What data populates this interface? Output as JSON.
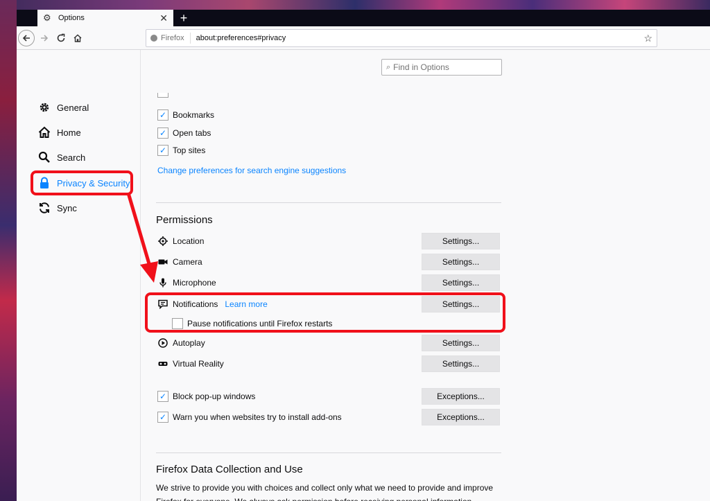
{
  "browser": {
    "tab_title": "Options",
    "new_tab": "+",
    "url_identity": "Firefox",
    "url": "about:preferences#privacy"
  },
  "sidebar": {
    "items": [
      {
        "label": "General",
        "icon": "gear-icon"
      },
      {
        "label": "Home",
        "icon": "home-icon"
      },
      {
        "label": "Search",
        "icon": "search-icon"
      },
      {
        "label": "Privacy & Security",
        "icon": "lock-icon",
        "active": true
      },
      {
        "label": "Sync",
        "icon": "sync-icon"
      }
    ]
  },
  "search": {
    "placeholder": "Find in Options"
  },
  "suggestions": {
    "items": [
      {
        "label": "Bookmarks",
        "checked": true
      },
      {
        "label": "Open tabs",
        "checked": true
      },
      {
        "label": "Top sites",
        "checked": true
      }
    ],
    "change_link": "Change preferences for search engine suggestions"
  },
  "permissions": {
    "title": "Permissions",
    "items": [
      {
        "label": "Location",
        "icon": "location-icon",
        "button": "Settings..."
      },
      {
        "label": "Camera",
        "icon": "camera-icon",
        "button": "Settings..."
      },
      {
        "label": "Microphone",
        "icon": "microphone-icon",
        "button": "Settings..."
      },
      {
        "label": "Notifications",
        "icon": "notification-icon",
        "button": "Settings...",
        "learn_more": "Learn more"
      },
      {
        "label": "Autoplay",
        "icon": "autoplay-icon",
        "button": "Settings..."
      },
      {
        "label": "Virtual Reality",
        "icon": "vr-icon",
        "button": "Settings..."
      }
    ],
    "pause_notifications": {
      "label": "Pause notifications until Firefox restarts",
      "checked": false
    },
    "block_popups": {
      "label": "Block pop-up windows",
      "checked": true,
      "button": "Exceptions..."
    },
    "warn_addons": {
      "label": "Warn you when websites try to install add-ons",
      "checked": true,
      "button": "Exceptions..."
    }
  },
  "data_collection": {
    "title": "Firefox Data Collection and Use",
    "text_line1": "We strive to provide you with choices and collect only what we need to provide and improve",
    "text_line2": "Firefox for everyone. We always ask permission before receiving personal information."
  },
  "colors": {
    "accent": "#0a84ff",
    "annotation": "#f0101a"
  }
}
